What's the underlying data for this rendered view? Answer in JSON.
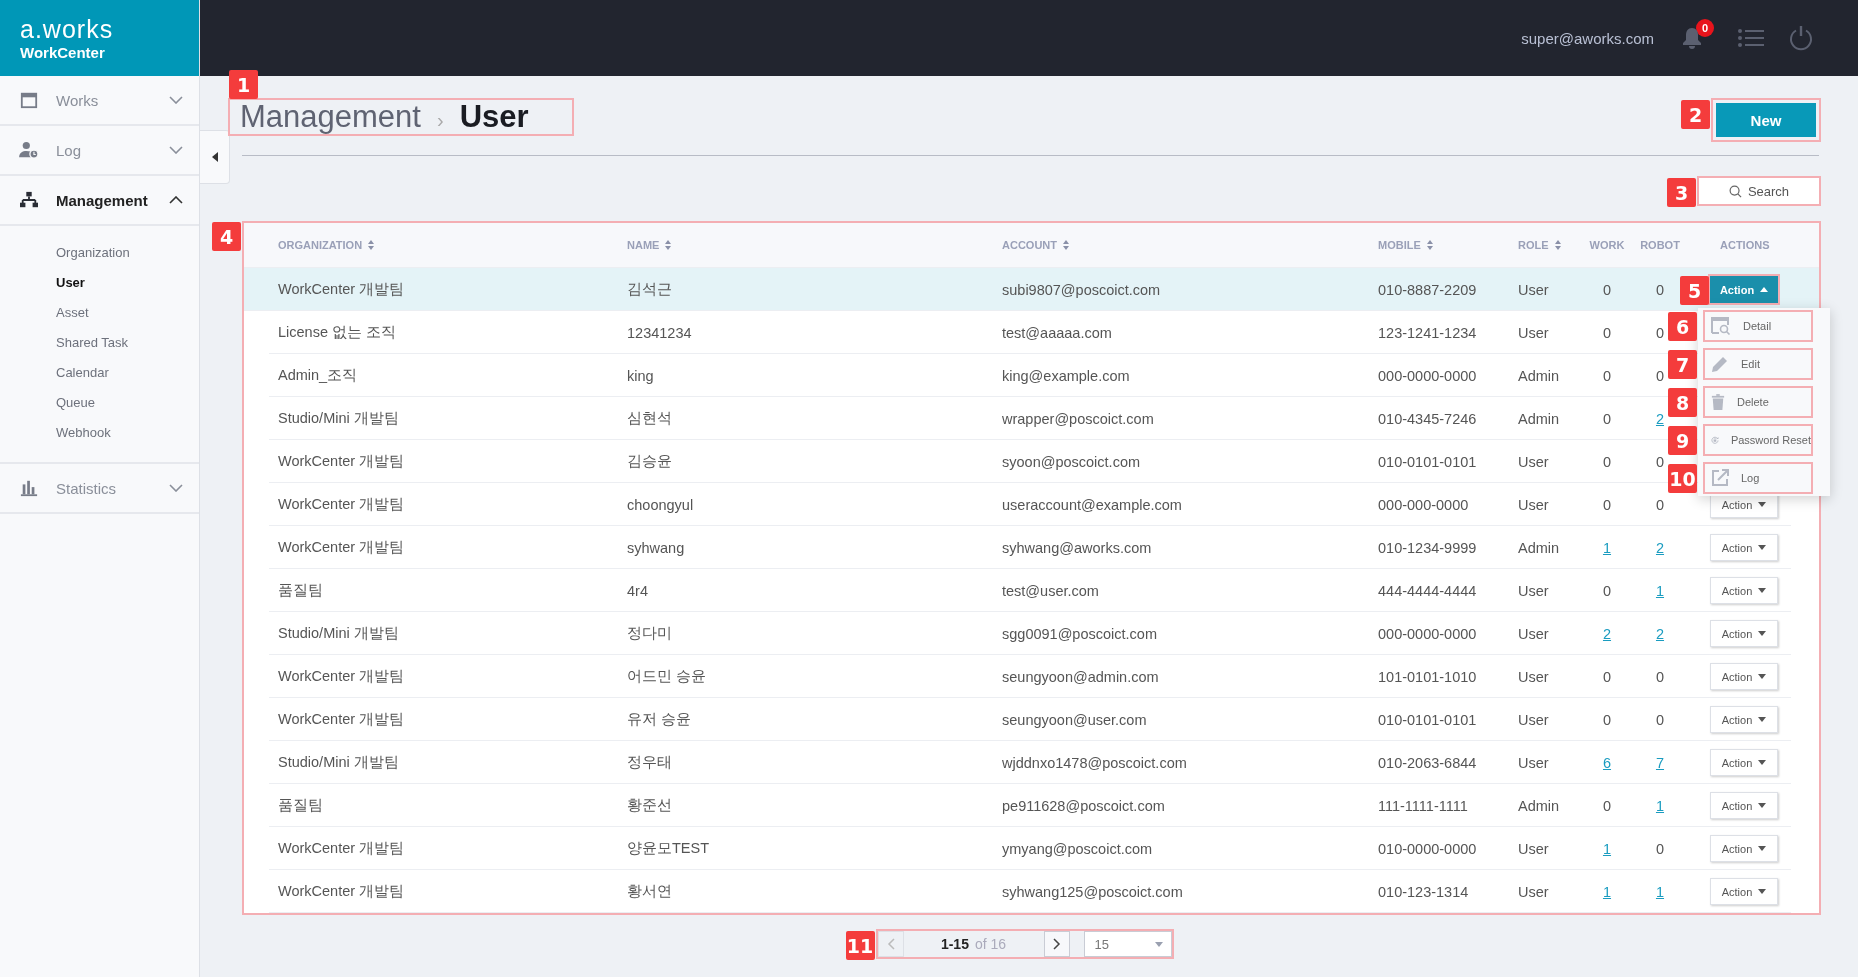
{
  "brand": {
    "logo": "a.works",
    "product": "WorkCenter"
  },
  "topbar": {
    "user": "super@aworks.com",
    "notifications": "0"
  },
  "sidebar": {
    "items": [
      {
        "label": "Works",
        "expanded": false
      },
      {
        "label": "Log",
        "expanded": false
      },
      {
        "label": "Management",
        "expanded": true,
        "children": [
          {
            "label": "Organization",
            "selected": false
          },
          {
            "label": "User",
            "selected": true
          },
          {
            "label": "Asset",
            "selected": false
          },
          {
            "label": "Shared Task",
            "selected": false
          },
          {
            "label": "Calendar",
            "selected": false
          },
          {
            "label": "Queue",
            "selected": false
          },
          {
            "label": "Webhook",
            "selected": false
          }
        ]
      },
      {
        "label": "Statistics",
        "expanded": false
      }
    ]
  },
  "breadcrumb": {
    "parent": "Management",
    "separator": "›",
    "current": "User",
    "callout": "1"
  },
  "new_button": {
    "label": "New",
    "callout": "2"
  },
  "search_button": {
    "label": "Search",
    "callout": "3"
  },
  "table": {
    "callout": "4",
    "columns": [
      {
        "label": "ORGANIZATION",
        "sortable": true
      },
      {
        "label": "NAME",
        "sortable": true
      },
      {
        "label": "ACCOUNT",
        "sortable": true
      },
      {
        "label": "MOBILE",
        "sortable": true
      },
      {
        "label": "ROLE",
        "sortable": true
      },
      {
        "label": "WORK",
        "sortable": false
      },
      {
        "label": "ROBOT",
        "sortable": false
      },
      {
        "label": "ACTIONS",
        "sortable": false
      }
    ],
    "rows": [
      {
        "selected": true,
        "organization": "WorkCenter 개발팀",
        "name": "김석근",
        "account": "subi9807@poscoict.com",
        "mobile": "010-8887-2209",
        "role": "User",
        "work": {
          "text": "0",
          "link": false
        },
        "robot": {
          "text": "0",
          "link": false
        },
        "action": {
          "label": "Action",
          "open": true,
          "callout": "5"
        }
      },
      {
        "selected": false,
        "organization": "License 없는 조직",
        "name": "12341234",
        "account": "test@aaaaa.com",
        "mobile": "123-1241-1234",
        "role": "User",
        "work": {
          "text": "0",
          "link": false
        },
        "robot": {
          "text": "0",
          "link": false
        }
      },
      {
        "selected": false,
        "organization": "Admin_조직",
        "name": "king",
        "account": "king@example.com",
        "mobile": "000-0000-0000",
        "role": "Admin",
        "work": {
          "text": "0",
          "link": false
        },
        "robot": {
          "text": "0",
          "link": false
        }
      },
      {
        "selected": false,
        "organization": "Studio/Mini 개발팀",
        "name": "심현석",
        "account": "wrapper@poscoict.com",
        "mobile": "010-4345-7246",
        "role": "Admin",
        "work": {
          "text": "0",
          "link": false
        },
        "robot": {
          "text": "2",
          "link": true
        }
      },
      {
        "selected": false,
        "organization": "WorkCenter 개발팀",
        "name": "김승윤",
        "account": "syoon@poscoict.com",
        "mobile": "010-0101-0101",
        "role": "User",
        "work": {
          "text": "0",
          "link": false
        },
        "robot": {
          "text": "0",
          "link": false
        }
      },
      {
        "selected": false,
        "organization": "WorkCenter 개발팀",
        "name": "choongyul",
        "account": "useraccount@example.com",
        "mobile": "000-000-0000",
        "role": "User",
        "work": {
          "text": "0",
          "link": false
        },
        "robot": {
          "text": "0",
          "link": false
        },
        "action": {
          "label": "Action",
          "open": false
        }
      },
      {
        "selected": false,
        "organization": "WorkCenter 개발팀",
        "name": "syhwang",
        "account": "syhwang@aworks.com",
        "mobile": "010-1234-9999",
        "role": "Admin",
        "work": {
          "text": "1",
          "link": true
        },
        "robot": {
          "text": "2",
          "link": true
        },
        "action": {
          "label": "Action",
          "open": false
        }
      },
      {
        "selected": false,
        "organization": "품질팀",
        "name": "4r4",
        "account": "test@user.com",
        "mobile": "444-4444-4444",
        "role": "User",
        "work": {
          "text": "0",
          "link": false
        },
        "robot": {
          "text": "1",
          "link": true
        },
        "action": {
          "label": "Action",
          "open": false
        }
      },
      {
        "selected": false,
        "organization": "Studio/Mini 개발팀",
        "name": "정다미",
        "account": "sgg0091@poscoict.com",
        "mobile": "000-0000-0000",
        "role": "User",
        "work": {
          "text": "2",
          "link": true
        },
        "robot": {
          "text": "2",
          "link": true
        },
        "action": {
          "label": "Action",
          "open": false
        }
      },
      {
        "selected": false,
        "organization": "WorkCenter 개발팀",
        "name": "어드민 승윤",
        "account": "seungyoon@admin.com",
        "mobile": "101-0101-1010",
        "role": "User",
        "work": {
          "text": "0",
          "link": false
        },
        "robot": {
          "text": "0",
          "link": false
        },
        "action": {
          "label": "Action",
          "open": false
        }
      },
      {
        "selected": false,
        "organization": "WorkCenter 개발팀",
        "name": "유저 승윤",
        "account": "seungyoon@user.com",
        "mobile": "010-0101-0101",
        "role": "User",
        "work": {
          "text": "0",
          "link": false
        },
        "robot": {
          "text": "0",
          "link": false
        },
        "action": {
          "label": "Action",
          "open": false
        }
      },
      {
        "selected": false,
        "organization": "Studio/Mini 개발팀",
        "name": "정우태",
        "account": "wjddnxo1478@poscoict.com",
        "mobile": "010-2063-6844",
        "role": "User",
        "work": {
          "text": "6",
          "link": true
        },
        "robot": {
          "text": "7",
          "link": true
        },
        "action": {
          "label": "Action",
          "open": false
        }
      },
      {
        "selected": false,
        "organization": "품질팀",
        "name": "황준선",
        "account": "pe911628@poscoict.com",
        "mobile": "111-1111-1111",
        "role": "Admin",
        "work": {
          "text": "0",
          "link": false
        },
        "robot": {
          "text": "1",
          "link": true
        },
        "action": {
          "label": "Action",
          "open": false
        }
      },
      {
        "selected": false,
        "organization": "WorkCenter 개발팀",
        "name": "양윤모TEST",
        "account": "ymyang@poscoict.com",
        "mobile": "010-0000-0000",
        "role": "User",
        "work": {
          "text": "1",
          "link": true
        },
        "robot": {
          "text": "0",
          "link": false
        },
        "action": {
          "label": "Action",
          "open": false
        }
      },
      {
        "selected": false,
        "organization": "WorkCenter 개발팀",
        "name": "황서연",
        "account": "syhwang125@poscoict.com",
        "mobile": "010-123-1314",
        "role": "User",
        "work": {
          "text": "1",
          "link": true
        },
        "robot": {
          "text": "1",
          "link": true
        },
        "action": {
          "label": "Action",
          "open": false
        }
      }
    ]
  },
  "action_menu": {
    "items": [
      {
        "label": "Detail",
        "callout": "6"
      },
      {
        "label": "Edit",
        "callout": "7"
      },
      {
        "label": "Delete",
        "callout": "8"
      },
      {
        "label": "Password Reset",
        "callout": "9"
      },
      {
        "label": "Log",
        "callout": "10"
      }
    ]
  },
  "pagination": {
    "range": "1-15",
    "total": "of 16",
    "page_size": "15",
    "prev_disabled": true,
    "callout": "11"
  }
}
